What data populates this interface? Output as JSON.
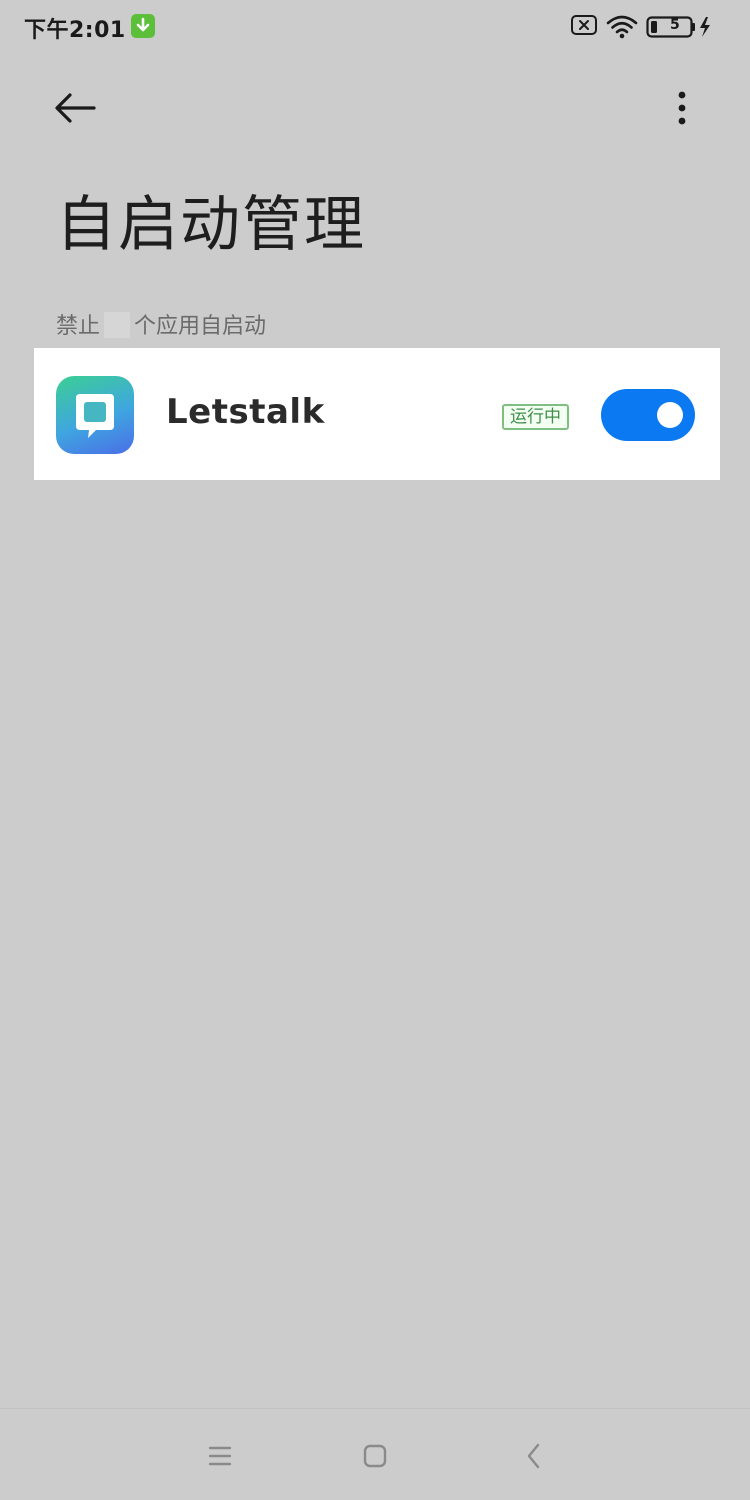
{
  "status_bar": {
    "time": "下午2:01",
    "icons": [
      "download-notification-icon",
      "sim-disabled-icon",
      "wifi-icon",
      "battery-charging-icon"
    ],
    "battery_label": "5"
  },
  "toolbar": {
    "back_icon": "arrow-left-icon",
    "more_icon": "more-vertical-icon"
  },
  "page": {
    "title": "自启动管理",
    "section_label_prefix": "禁止",
    "section_label_suffix": "个应用自启动"
  },
  "apps": [
    {
      "name": "Letstalk",
      "icon": "letstalk-app-icon",
      "status_badge": "运行中",
      "autostart_enabled": true
    }
  ],
  "nav_bar": {
    "icons": [
      "menu-icon",
      "home-icon",
      "back-icon"
    ]
  },
  "colors": {
    "background": "#cccccc",
    "toggle_on": "#0a79f2",
    "badge_green": "#3f8f4a",
    "download_badge": "#5cbf3a"
  }
}
